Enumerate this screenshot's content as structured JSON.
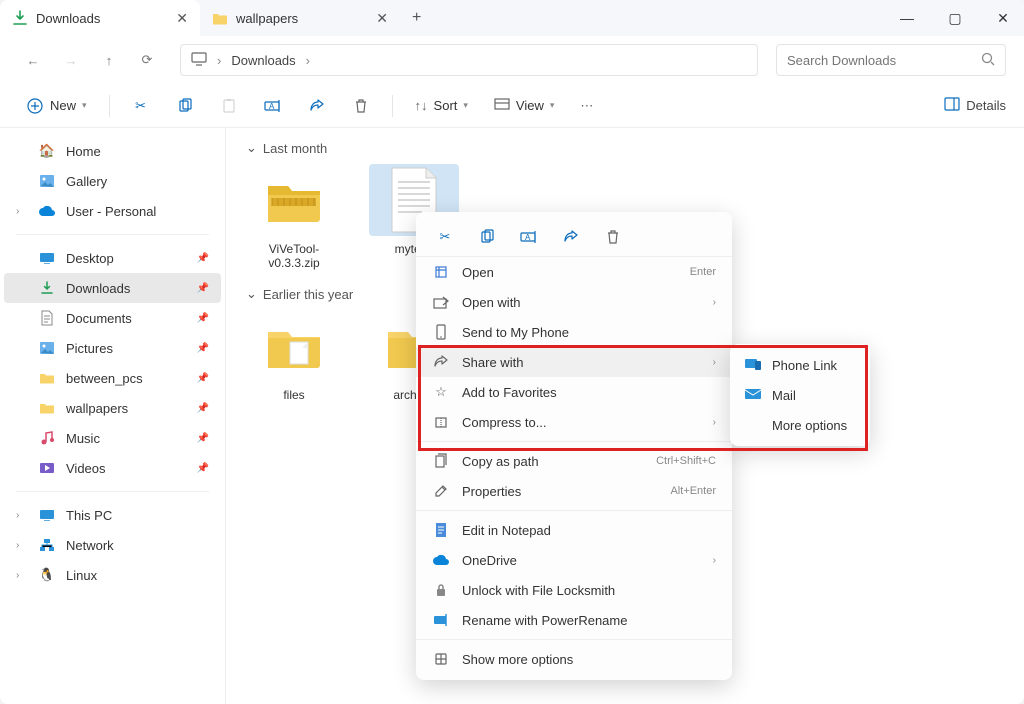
{
  "tabs": [
    {
      "label": "Downloads",
      "active": true
    },
    {
      "label": "wallpapers",
      "active": false
    }
  ],
  "address": {
    "location": "Downloads"
  },
  "search": {
    "placeholder": "Search Downloads"
  },
  "toolbar": {
    "new_label": "New",
    "sort_label": "Sort",
    "view_label": "View",
    "details_label": "Details"
  },
  "sidebar": {
    "home": "Home",
    "gallery": "Gallery",
    "user_personal": "User - Personal",
    "desktop": "Desktop",
    "downloads": "Downloads",
    "documents": "Documents",
    "pictures": "Pictures",
    "between_pcs": "between_pcs",
    "wallpapers": "wallpapers",
    "music": "Music",
    "videos": "Videos",
    "this_pc": "This PC",
    "network": "Network",
    "linux": "Linux"
  },
  "groups": [
    {
      "label": "Last month",
      "items": [
        {
          "label": "ViVeTool-v0.3.3.zip",
          "type": "zip"
        },
        {
          "label": "mytext.",
          "type": "txt",
          "selected": true
        }
      ]
    },
    {
      "label": "Earlier this year",
      "items": [
        {
          "label": "files",
          "type": "folder"
        },
        {
          "label": "archival",
          "type": "folder"
        }
      ]
    }
  ],
  "context": {
    "open": "Open",
    "open_sc": "Enter",
    "open_with": "Open with",
    "send_phone": "Send to My Phone",
    "share_with": "Share with",
    "add_fav": "Add to Favorites",
    "compress": "Compress to...",
    "copy_path": "Copy as path",
    "copy_path_sc": "Ctrl+Shift+C",
    "properties": "Properties",
    "properties_sc": "Alt+Enter",
    "edit_notepad": "Edit in Notepad",
    "onedrive": "OneDrive",
    "unlock": "Unlock with File Locksmith",
    "rename_power": "Rename with PowerRename",
    "show_more": "Show more options"
  },
  "submenu": {
    "phone_link": "Phone Link",
    "mail": "Mail",
    "more_options": "More options"
  }
}
